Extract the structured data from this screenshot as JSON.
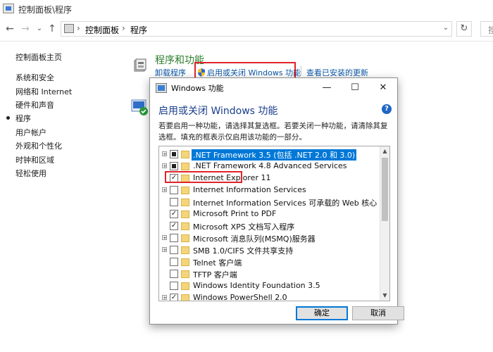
{
  "window": {
    "title": "控制面板\\程序"
  },
  "nav": {
    "back": "←",
    "forward": "→",
    "history": "⌄",
    "up": "↑",
    "breadcrumb": [
      "控制面板",
      "程序"
    ],
    "crumb_sep": "›",
    "dropdown": "⌄",
    "refresh": "↻",
    "search_fragment": "搜"
  },
  "sidebar": {
    "home": "控制面板主页",
    "items": [
      "系统和安全",
      "网络和 Internet",
      "硬件和声音",
      "程序",
      "用户帐户",
      "外观和个性化",
      "时钟和区域",
      "轻松使用"
    ],
    "active_index": 3
  },
  "main": {
    "programs_title": "程序和功能",
    "links": {
      "uninstall": "卸载程序",
      "windows_features": "启用或关闭 Windows 功能",
      "installed_updates": "查看已安装的更新"
    }
  },
  "dialog": {
    "title": "Windows 功能",
    "minimize": "—",
    "maximize": "☐",
    "close": "✕",
    "heading": "启用或关闭 Windows 功能",
    "help": "?",
    "description": "若要启用一种功能，请选择其复选框。若要关闭一种功能，请清除其复选框。填充的框表示仅启用该功能的一部分。",
    "scroll_up": "▲",
    "scroll_down": "▼",
    "features": [
      {
        "label": ".NET Framework 3.5 (包括 .NET 2.0 和 3.0)",
        "state": "partial",
        "expandable": true,
        "selected": true
      },
      {
        "label": ".NET Framework 4.8 Advanced Services",
        "state": "partial",
        "expandable": true,
        "selected": false
      },
      {
        "label": "Internet Explorer 11",
        "state": "checked",
        "expandable": false,
        "selected": false
      },
      {
        "label": "Internet Information Services",
        "state": "unchecked",
        "expandable": true,
        "selected": false
      },
      {
        "label": "Internet Information Services 可承载的 Web 核心",
        "state": "unchecked",
        "expandable": false,
        "selected": false
      },
      {
        "label": "Microsoft Print to PDF",
        "state": "checked",
        "expandable": false,
        "selected": false
      },
      {
        "label": "Microsoft XPS 文档写入程序",
        "state": "checked",
        "expandable": false,
        "selected": false
      },
      {
        "label": "Microsoft 消息队列(MSMQ)服务器",
        "state": "unchecked",
        "expandable": true,
        "selected": false
      },
      {
        "label": "SMB 1.0/CIFS 文件共享支持",
        "state": "unchecked",
        "expandable": true,
        "selected": false
      },
      {
        "label": "Telnet 客户端",
        "state": "unchecked",
        "expandable": false,
        "selected": false
      },
      {
        "label": "TFTP 客户端",
        "state": "unchecked",
        "expandable": false,
        "selected": false
      },
      {
        "label": "Windows Identity Foundation 3.5",
        "state": "unchecked",
        "expandable": false,
        "selected": false
      },
      {
        "label": "Windows PowerShell 2.0",
        "state": "checked",
        "expandable": true,
        "selected": false
      }
    ],
    "ok": "确定",
    "cancel": "取消"
  },
  "colors": {
    "link": "#0b57a6",
    "programs_title": "#2a7d2a",
    "highlight_box": "#e0242a",
    "selection": "#0078d7",
    "dialog_heading": "#1a3e8c"
  },
  "icons": [
    "control-panel-icon",
    "programs-icon",
    "shield-icon",
    "default-programs-icon",
    "help-icon",
    "folder-icon"
  ]
}
